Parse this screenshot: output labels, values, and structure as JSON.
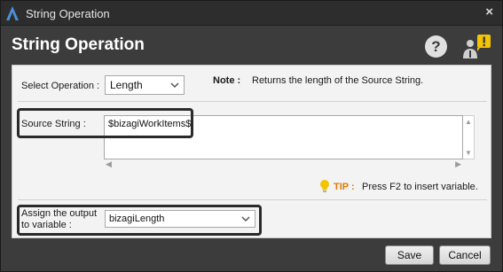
{
  "window": {
    "title": "String Operation",
    "close_label": "×"
  },
  "header": {
    "title": "String Operation",
    "help_label": "?"
  },
  "form": {
    "select_operation_label": "Select Operation :",
    "operation_value": "Length",
    "note_label": "Note :",
    "note_text": "Returns the length of the Source String.",
    "source_string_label": "Source String :",
    "source_string_value": "$bizagiWorkItems$",
    "tip_label": "TIP :",
    "tip_text": "Press F2 to insert variable.",
    "assign_output_label_line1": "Assign the output",
    "assign_output_label_line2": "to variable :",
    "output_variable_value": "bizagiLength"
  },
  "footer": {
    "save_label": "Save",
    "cancel_label": "Cancel"
  },
  "colors": {
    "window_bg": "#3c3c3c",
    "panel_bg": "#f3f3f3",
    "tip_orange": "#e07b00",
    "alert_yellow": "#f5c400"
  },
  "icons": [
    "bizagi-logo-icon",
    "close-icon",
    "help-icon",
    "user-alert-icon",
    "chevron-down-icon",
    "lightbulb-icon"
  ]
}
